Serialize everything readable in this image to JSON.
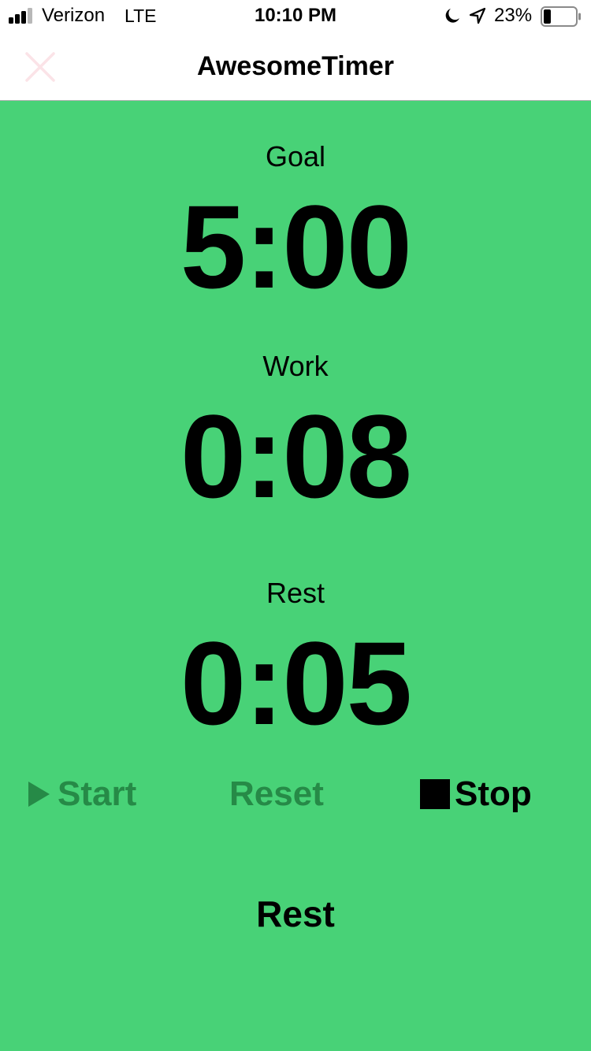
{
  "status_bar": {
    "carrier": "Verizon",
    "network": "LTE",
    "time": "10:10 PM",
    "battery": "23%",
    "battery_level": 0.23,
    "signal_bars": 3,
    "signal_total": 4,
    "icons": [
      "signal-icon",
      "moon-icon",
      "location-icon",
      "battery-icon"
    ]
  },
  "nav": {
    "title": "AwesomeTimer",
    "close_icon": "close-icon"
  },
  "timers": {
    "goal": {
      "label": "Goal",
      "value": "5:00"
    },
    "work": {
      "label": "Work",
      "value": "0:08"
    },
    "rest": {
      "label": "Rest",
      "value": "0:05"
    }
  },
  "controls": {
    "start_label": "Start",
    "reset_label": "Reset",
    "stop_label": "Stop",
    "start_icon": "play-icon",
    "stop_icon": "stop-icon"
  },
  "phase": "Rest",
  "colors": {
    "background": "#48d277",
    "text": "#000000",
    "disabled": "#268a47",
    "close_icon": "#fbe3e7",
    "divider": "#b2b2b2"
  }
}
